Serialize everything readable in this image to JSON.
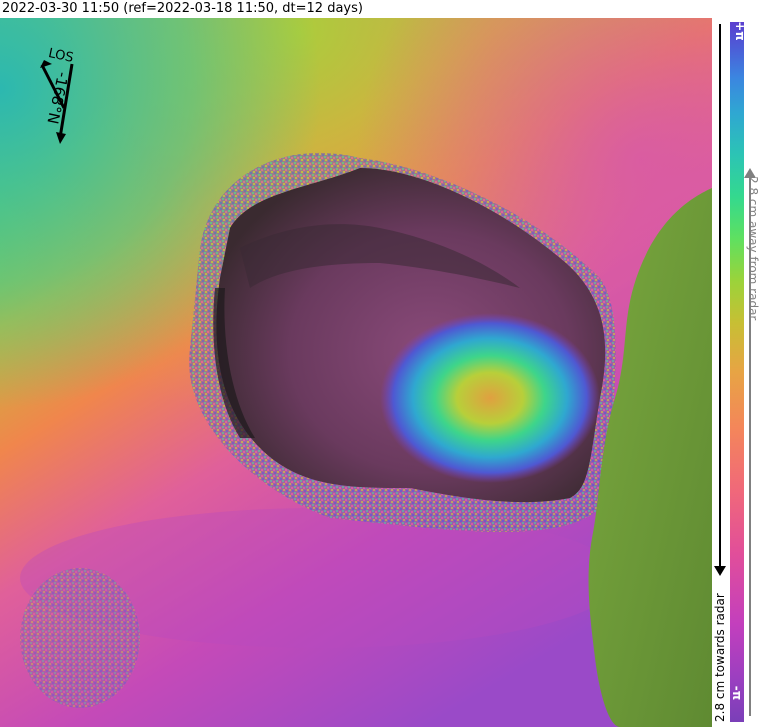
{
  "title": "2022-03-30 11:50 (ref=2022-03-18 11:50, dt=12 days)",
  "compass": {
    "los_label": "LOS",
    "heading_label": "-168°N"
  },
  "colorbar": {
    "top_label": "+π",
    "bottom_label": "-π",
    "away_label": "2.8 cm away from radar",
    "toward_label": "2.8 cm towards radar",
    "colors": [
      "#7a3fb8",
      "#c33fbd",
      "#f0687a",
      "#e7a444",
      "#9bd33a",
      "#34d98e",
      "#2fa7d2",
      "#5b3fcf"
    ]
  },
  "map": {
    "outside_area_color": "#6f9a3a",
    "background_colors": {
      "northwest": "#3dbf8f",
      "north": "#c8b43a",
      "south": "#c44ab8",
      "crater": "#5a3a4a",
      "deformation_center": "#c8d03a"
    }
  }
}
